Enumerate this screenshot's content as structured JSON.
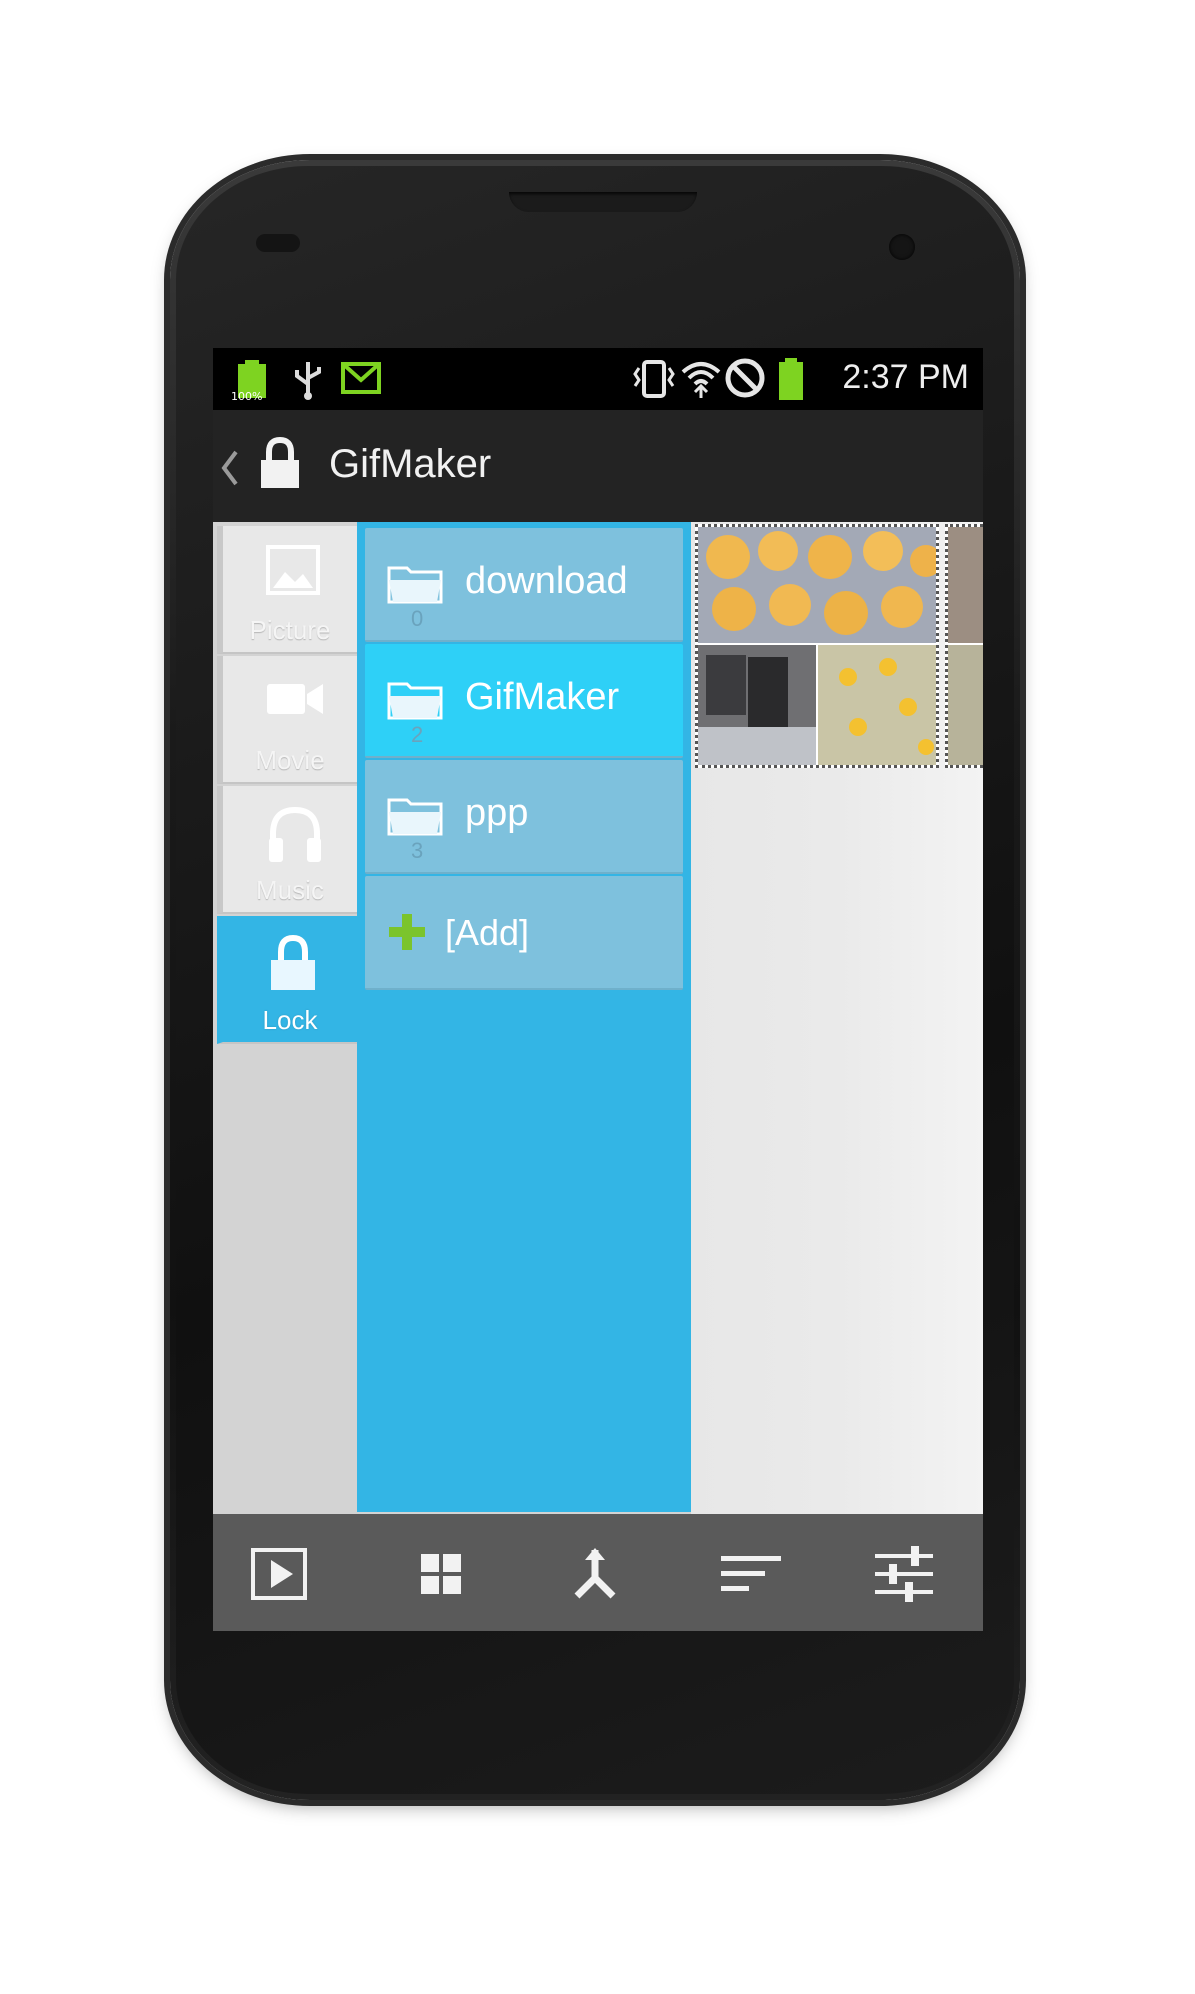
{
  "status_bar": {
    "battery_level_label": "100%",
    "time": "2:37 PM",
    "icons_left": [
      "battery-icon",
      "usb-icon",
      "mail-icon"
    ],
    "icons_right": [
      "vibrate-icon",
      "wifi-icon",
      "blocked-icon",
      "battery-full-icon"
    ]
  },
  "action_bar": {
    "back_icon": "chevron-left-icon",
    "lock_icon": "lock-icon",
    "title": "GifMaker"
  },
  "categories": [
    {
      "label": "Picture",
      "icon": "picture-icon",
      "active": false
    },
    {
      "label": "Movie",
      "icon": "movie-icon",
      "active": false
    },
    {
      "label": "Music",
      "icon": "headphones-icon",
      "active": false
    },
    {
      "label": "Lock",
      "icon": "lock-icon",
      "active": true
    }
  ],
  "folders": [
    {
      "label": "download",
      "count": "0",
      "active": false
    },
    {
      "label": "GifMaker",
      "count": "2",
      "active": true
    },
    {
      "label": "ppp",
      "count": "3",
      "active": false
    }
  ],
  "add_item": {
    "label": "[Add]",
    "icon": "plus-icon"
  },
  "toolbar": {
    "icons": [
      "play-icon",
      "grid-icon",
      "merge-icon",
      "sort-icon",
      "settings-sliders-icon"
    ]
  },
  "colors": {
    "accent": "#33b5e5",
    "folder_bg": "#7ec1dd",
    "folder_active": "#2ed0f7",
    "add_green": "#7bc42c",
    "status_green": "#7ed321"
  }
}
